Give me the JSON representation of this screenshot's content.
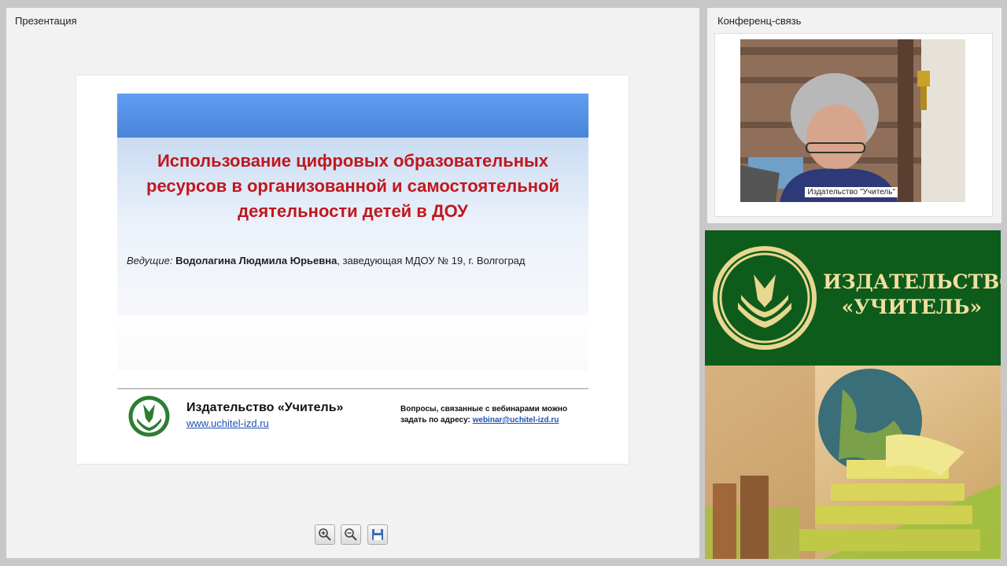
{
  "presentation_panel": {
    "title": "Презентация",
    "slide": {
      "title": "Использование цифровых образовательных ресурсов в организованной и самостоятельной деятельности детей в ДОУ",
      "presenter_role": "Ведущие:",
      "presenter_name": "Водолагина Людмила Юрьевна",
      "presenter_position": ", заведующая МДОУ № 19, г. Волгоград",
      "footer_publisher": "Издательство «Учитель»",
      "footer_url": "www.uchitel-izd.ru",
      "footer_question_line1": "Вопросы, связанные с вебинарами можно",
      "footer_question_line2": "задать по адресу: ",
      "footer_email": "webinar@uchitel-izd.ru"
    },
    "toolbar": {
      "zoom_in_icon": "zoom-in-icon",
      "zoom_out_icon": "zoom-out-icon",
      "save_icon": "floppy-disk-icon"
    }
  },
  "conference_panel": {
    "title": "Конференц-связь",
    "video_label": "Издательство \"Учитель\""
  },
  "promo": {
    "title_line1": "ИЗДАТЕЛЬСТВО",
    "title_line2": "«УЧИТЕЛЬ»"
  },
  "colors": {
    "slide_title": "#c0171e",
    "link": "#1f4fb3",
    "promo_green": "#0d5c1c",
    "promo_gold": "#f2dfa0"
  }
}
